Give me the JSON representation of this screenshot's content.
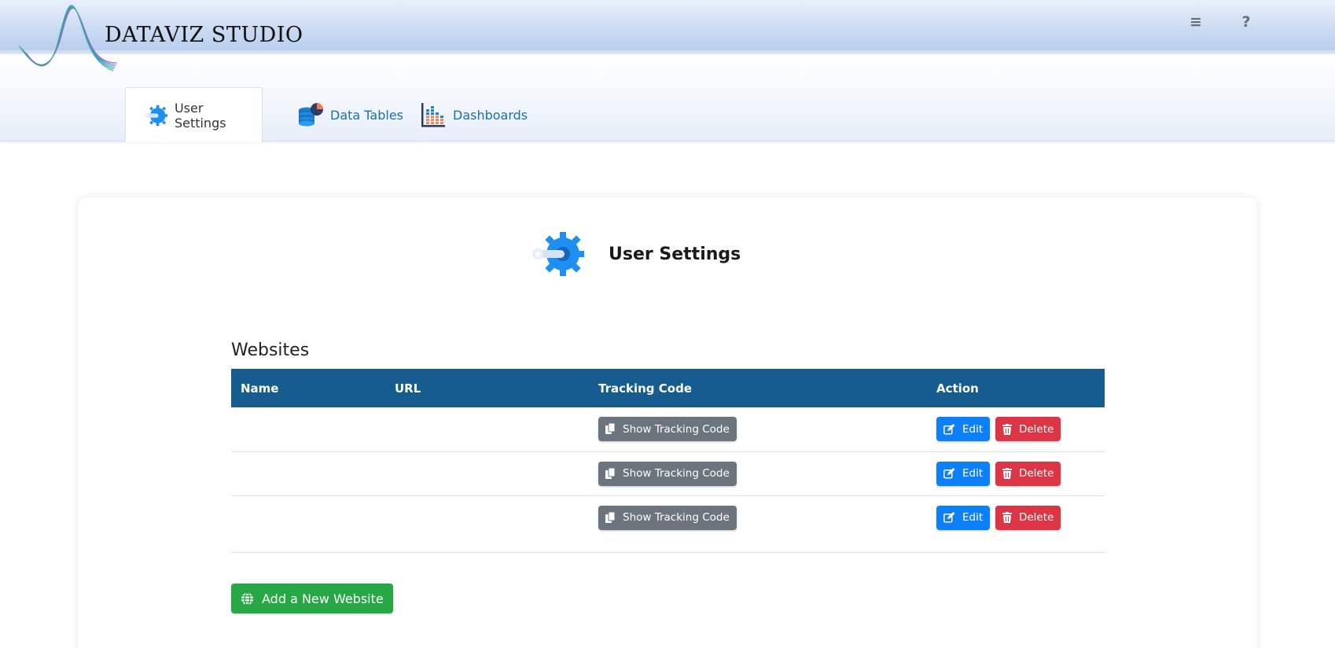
{
  "header": {
    "brand": "DATAVIZ STUDIO",
    "menu_icon": "hamburger-icon",
    "help_icon": "question-icon"
  },
  "tabs": [
    {
      "label": "User Settings",
      "icon": "gear-key-icon",
      "active": true
    },
    {
      "label": "Data Tables",
      "icon": "database-chart-icon",
      "active": false
    },
    {
      "label": "Dashboards",
      "icon": "bar-chart-icon",
      "active": false
    }
  ],
  "card": {
    "title": "User Settings",
    "icon": "gear-key-icon"
  },
  "websites": {
    "section_title": "Websites",
    "columns": [
      "Name",
      "URL",
      "Tracking Code",
      "Action"
    ],
    "rows": [
      {
        "name": "",
        "url": "",
        "tracking_label": "Show Tracking Code",
        "edit_label": "Edit",
        "delete_label": "Delete"
      },
      {
        "name": "",
        "url": "",
        "tracking_label": "Show Tracking Code",
        "edit_label": "Edit",
        "delete_label": "Delete"
      },
      {
        "name": "",
        "url": "",
        "tracking_label": "Show Tracking Code",
        "edit_label": "Edit",
        "delete_label": "Delete"
      }
    ],
    "add_label": "Add a New Website"
  },
  "colors": {
    "table_header": "#165c8e",
    "primary": "#0d7ff7",
    "danger": "#dc3545",
    "success": "#28a745",
    "secondary": "#6c757d",
    "link": "#1a6fb0"
  }
}
